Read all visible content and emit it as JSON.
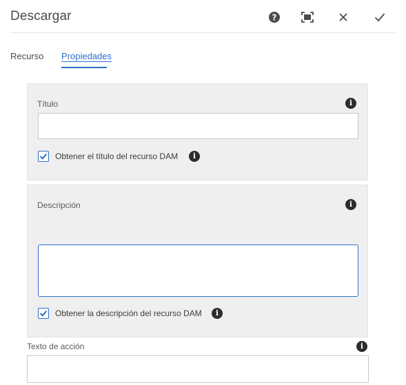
{
  "dialog": {
    "title": "Descargar",
    "actions": [
      {
        "name": "help-icon"
      },
      {
        "name": "fullscreen-icon"
      },
      {
        "name": "close-icon"
      },
      {
        "name": "confirm-icon"
      }
    ]
  },
  "tabs": [
    {
      "label": "Recurso",
      "active": false
    },
    {
      "label": "Propiedades",
      "active": true
    }
  ],
  "form": {
    "title_field": {
      "label": "Título",
      "value": "",
      "checkbox_label": "Obtener el título del recurso DAM",
      "checked": true
    },
    "description_field": {
      "label": "Descripción",
      "value": "",
      "checkbox_label": "Obtener la descripción del recurso DAM",
      "checked": true
    },
    "action_text_field": {
      "label": "Texto de acción",
      "value": ""
    }
  },
  "colors": {
    "accent": "#2d6ec9",
    "panel_bg": "#efefef",
    "text": "#4b4b4b"
  }
}
